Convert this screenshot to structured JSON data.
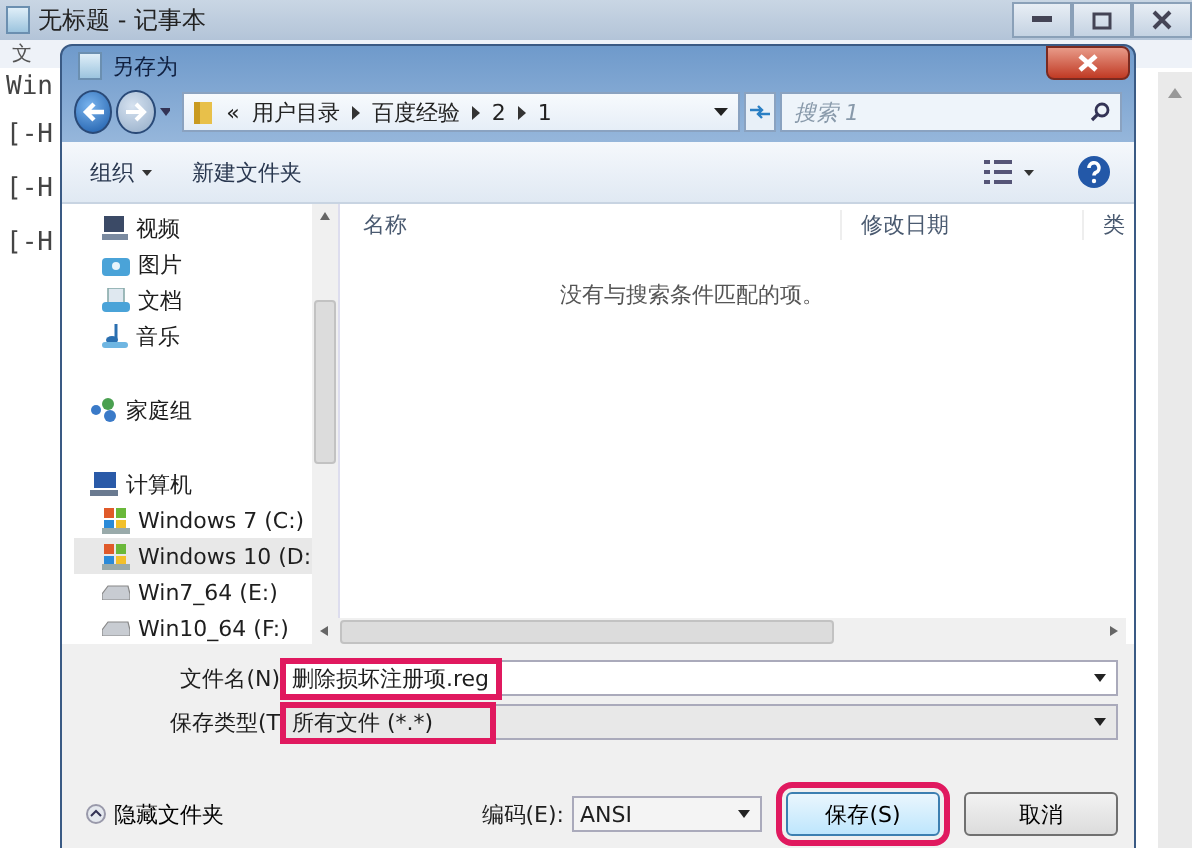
{
  "background_window": {
    "title": "无标题 - 记事本",
    "menu": [
      "文"
    ],
    "text_lines": [
      "Win",
      "[-H",
      "[-H",
      "[-H"
    ]
  },
  "dialog": {
    "title": "另存为",
    "address": {
      "prefix": "«",
      "path": [
        "用户目录",
        "百度经验",
        "2",
        "1"
      ]
    },
    "search": {
      "placeholder": "搜索 1"
    },
    "toolbar": {
      "organize": "组织",
      "new_folder": "新建文件夹"
    },
    "nav": [
      {
        "label": "视频",
        "kind": "video",
        "selected": false
      },
      {
        "label": "图片",
        "kind": "pictures",
        "selected": false
      },
      {
        "label": "文档",
        "kind": "documents",
        "selected": false
      },
      {
        "label": "音乐",
        "kind": "music",
        "selected": false
      },
      {
        "label": "家庭组",
        "kind": "homegroup",
        "selected": false
      },
      {
        "label": "计算机",
        "kind": "computer",
        "selected": false
      },
      {
        "label": "Windows 7 (C:)",
        "kind": "system-drive",
        "selected": false
      },
      {
        "label": "Windows 10 (D:",
        "kind": "system-drive",
        "selected": true
      },
      {
        "label": "Win7_64 (E:)",
        "kind": "drive",
        "selected": false
      },
      {
        "label": "Win10_64 (F:)",
        "kind": "drive",
        "selected": false
      }
    ],
    "columns": [
      "名称",
      "修改日期",
      "类"
    ],
    "empty_message": "没有与搜索条件匹配的项。",
    "filename": {
      "label": "文件名(N)",
      "value": "删除损坏注册项.reg",
      "highlighted": true
    },
    "filetype": {
      "label": "保存类型(T",
      "value": "所有文件 (*.*)",
      "highlighted": true
    },
    "hide_folders": "隐藏文件夹",
    "encoding": {
      "label": "编码(E):",
      "value": "ANSI"
    },
    "buttons": [
      {
        "label": "保存(S)",
        "highlighted": true
      },
      {
        "label": "取消",
        "highlighted": false
      }
    ]
  }
}
